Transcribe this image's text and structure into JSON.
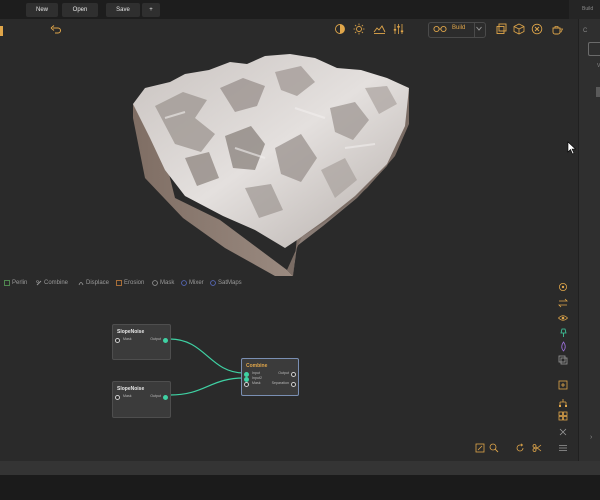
{
  "colors": {
    "accent": "#e0a64a",
    "connection": "#3fd1a3",
    "node_bg": "#3b3b3b",
    "node_selected_border": "#7a8fb3"
  },
  "toolbar": {
    "new_label": "New",
    "open_label": "Open",
    "save_label": "Save",
    "add_label": "+"
  },
  "right_panel": {
    "title": "Build",
    "marker": "C",
    "v_label": "V",
    "chevron": "›"
  },
  "viewport": {
    "undo_icon": "undo-icon",
    "build_label": "Build",
    "top_icons": [
      "sun-half-icon",
      "sun-icon",
      "landscape-icon",
      "sliders-icon"
    ],
    "right_icons": [
      "square-icon",
      "cube-icon",
      "close-circle-icon",
      "teapot-icon"
    ]
  },
  "palette": [
    {
      "label": "Perlin",
      "color": "#5aa05a"
    },
    {
      "label": "Combine",
      "color": "#8a8a8a"
    },
    {
      "label": "Displace",
      "color": "#8a8a8a"
    },
    {
      "label": "Erosion",
      "color": "#c8803c"
    },
    {
      "label": "Mask",
      "color": "#8a8a8a"
    },
    {
      "label": "Mixer",
      "color": "#5a6fc8"
    },
    {
      "label": "SatMaps",
      "color": "#5a6fc8"
    }
  ],
  "nodes": [
    {
      "title": "SlopeNoise",
      "input": "Mask",
      "output": "Output"
    },
    {
      "title": "SlopeNoise",
      "input": "Mask",
      "output": "Output"
    },
    {
      "title": "Combine",
      "inputs": [
        "Input",
        "Input2",
        "Mask"
      ],
      "outputs": [
        "Output",
        "Separation"
      ]
    }
  ],
  "graph_side_icons": [
    "target-icon",
    "swap-icon",
    "eye-icon",
    "pin-icon",
    "drop-icon",
    "copy-icon",
    "export-icon",
    "hierarchy-icon",
    "grid-icon",
    "close-x-icon",
    "menu-icon"
  ],
  "graph_bottom_icons": [
    "fit-icon",
    "search-icon",
    "refresh-icon",
    "scissors-icon"
  ]
}
